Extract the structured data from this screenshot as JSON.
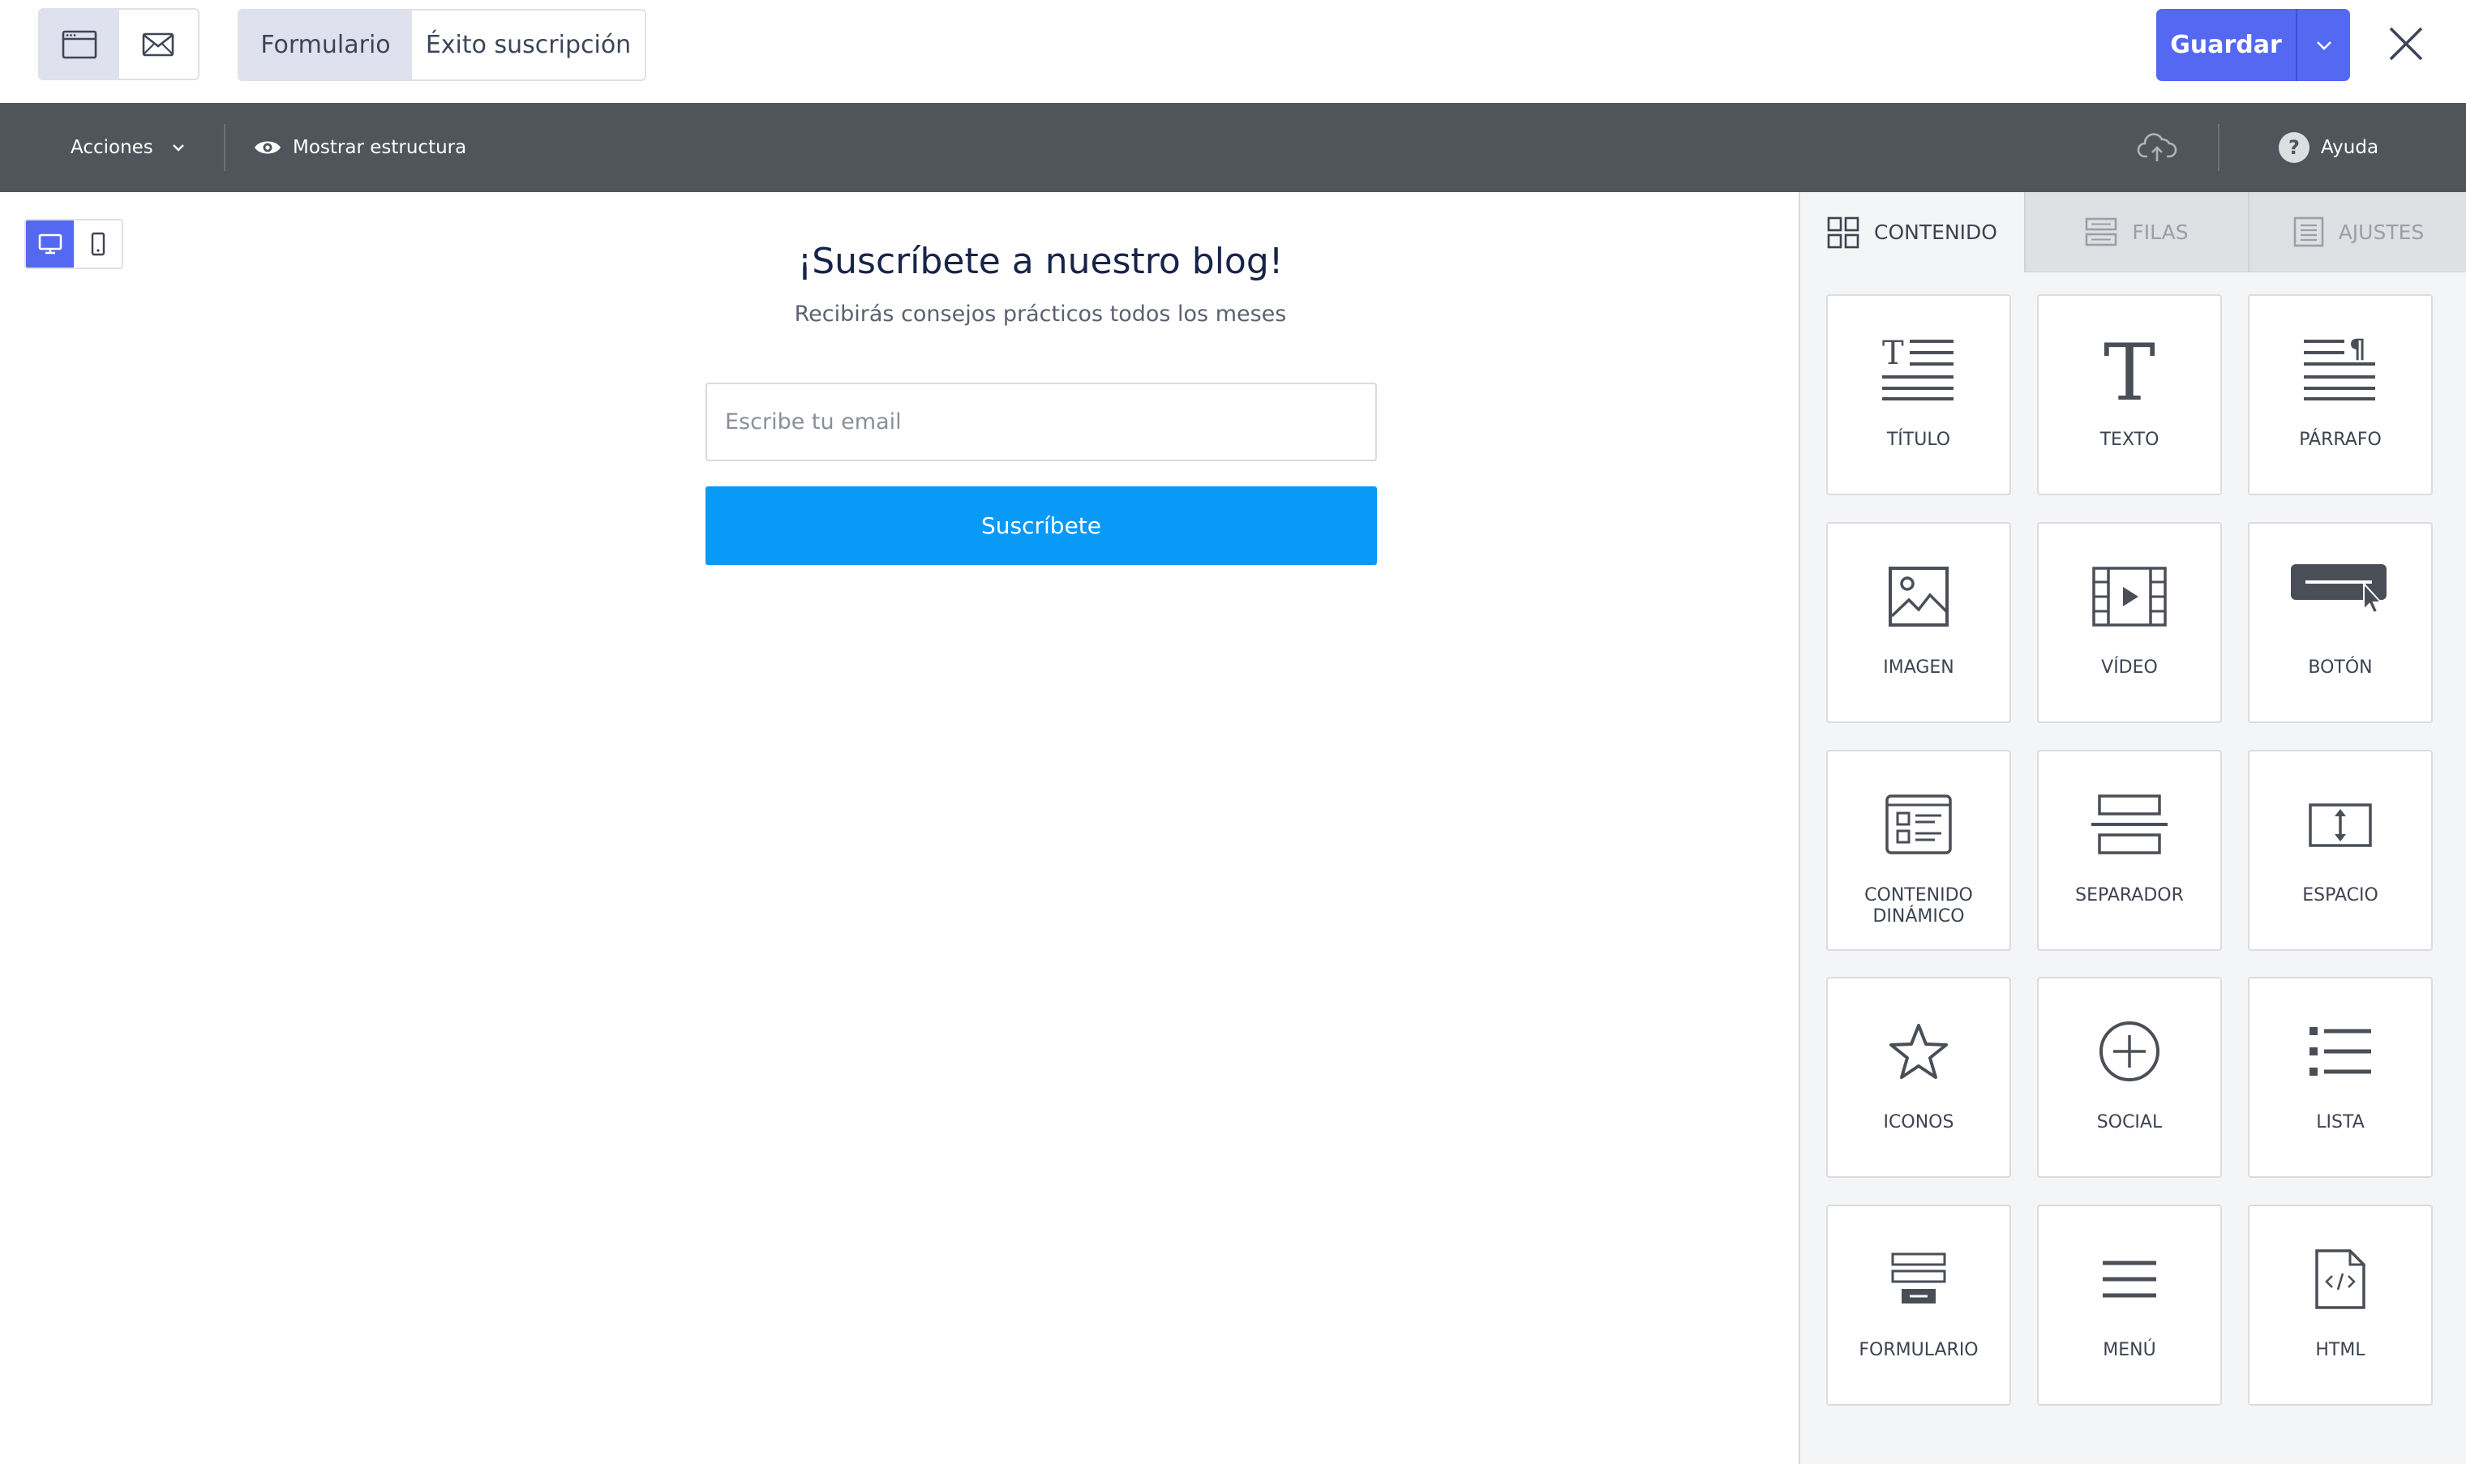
{
  "header": {
    "view_toggle": [
      {
        "icon": "browser-window-icon",
        "active": true
      },
      {
        "icon": "envelope-icon",
        "active": false
      }
    ],
    "tabs": [
      "Formulario",
      "Éxito suscripción"
    ],
    "save_label": "Guardar"
  },
  "toolbar": {
    "actions_label": "Acciones",
    "show_structure_label": "Mostrar estructura",
    "help_label": "Ayuda",
    "help_glyph": "?"
  },
  "canvas": {
    "title": "¡Suscríbete a nuestro blog!",
    "subtitle": "Recibirás consejos prácticos todos los meses",
    "email_placeholder": "Escribe tu email",
    "button_label": "Suscríbete"
  },
  "panel": {
    "tabs": [
      "CONTENIDO",
      "FILAS",
      "AJUSTES"
    ],
    "active_tab": "CONTENIDO",
    "blocks": [
      {
        "label": "TÍTULO",
        "icon": "title-icon"
      },
      {
        "label": "TEXTO",
        "icon": "text-icon"
      },
      {
        "label": "PÁRRAFO",
        "icon": "paragraph-icon"
      },
      {
        "label": "IMAGEN",
        "icon": "image-icon"
      },
      {
        "label": "VÍDEO",
        "icon": "video-icon"
      },
      {
        "label": "BOTÓN",
        "icon": "button-icon"
      },
      {
        "label": "CONTENIDO DINÁMICO",
        "icon": "dynamic-content-icon"
      },
      {
        "label": "SEPARADOR",
        "icon": "divider-icon"
      },
      {
        "label": "ESPACIO",
        "icon": "spacer-icon"
      },
      {
        "label": "ICONOS",
        "icon": "star-icon"
      },
      {
        "label": "SOCIAL",
        "icon": "social-plus-icon"
      },
      {
        "label": "LISTA",
        "icon": "list-icon"
      },
      {
        "label": "FORMULARIO",
        "icon": "form-icon"
      },
      {
        "label": "MENÚ",
        "icon": "menu-icon"
      },
      {
        "label": "HTML",
        "icon": "html-file-icon"
      }
    ]
  },
  "colors": {
    "accent": "#5468f2",
    "subscribe_button": "#0999f7",
    "toolbar_bg": "#4f555b"
  }
}
